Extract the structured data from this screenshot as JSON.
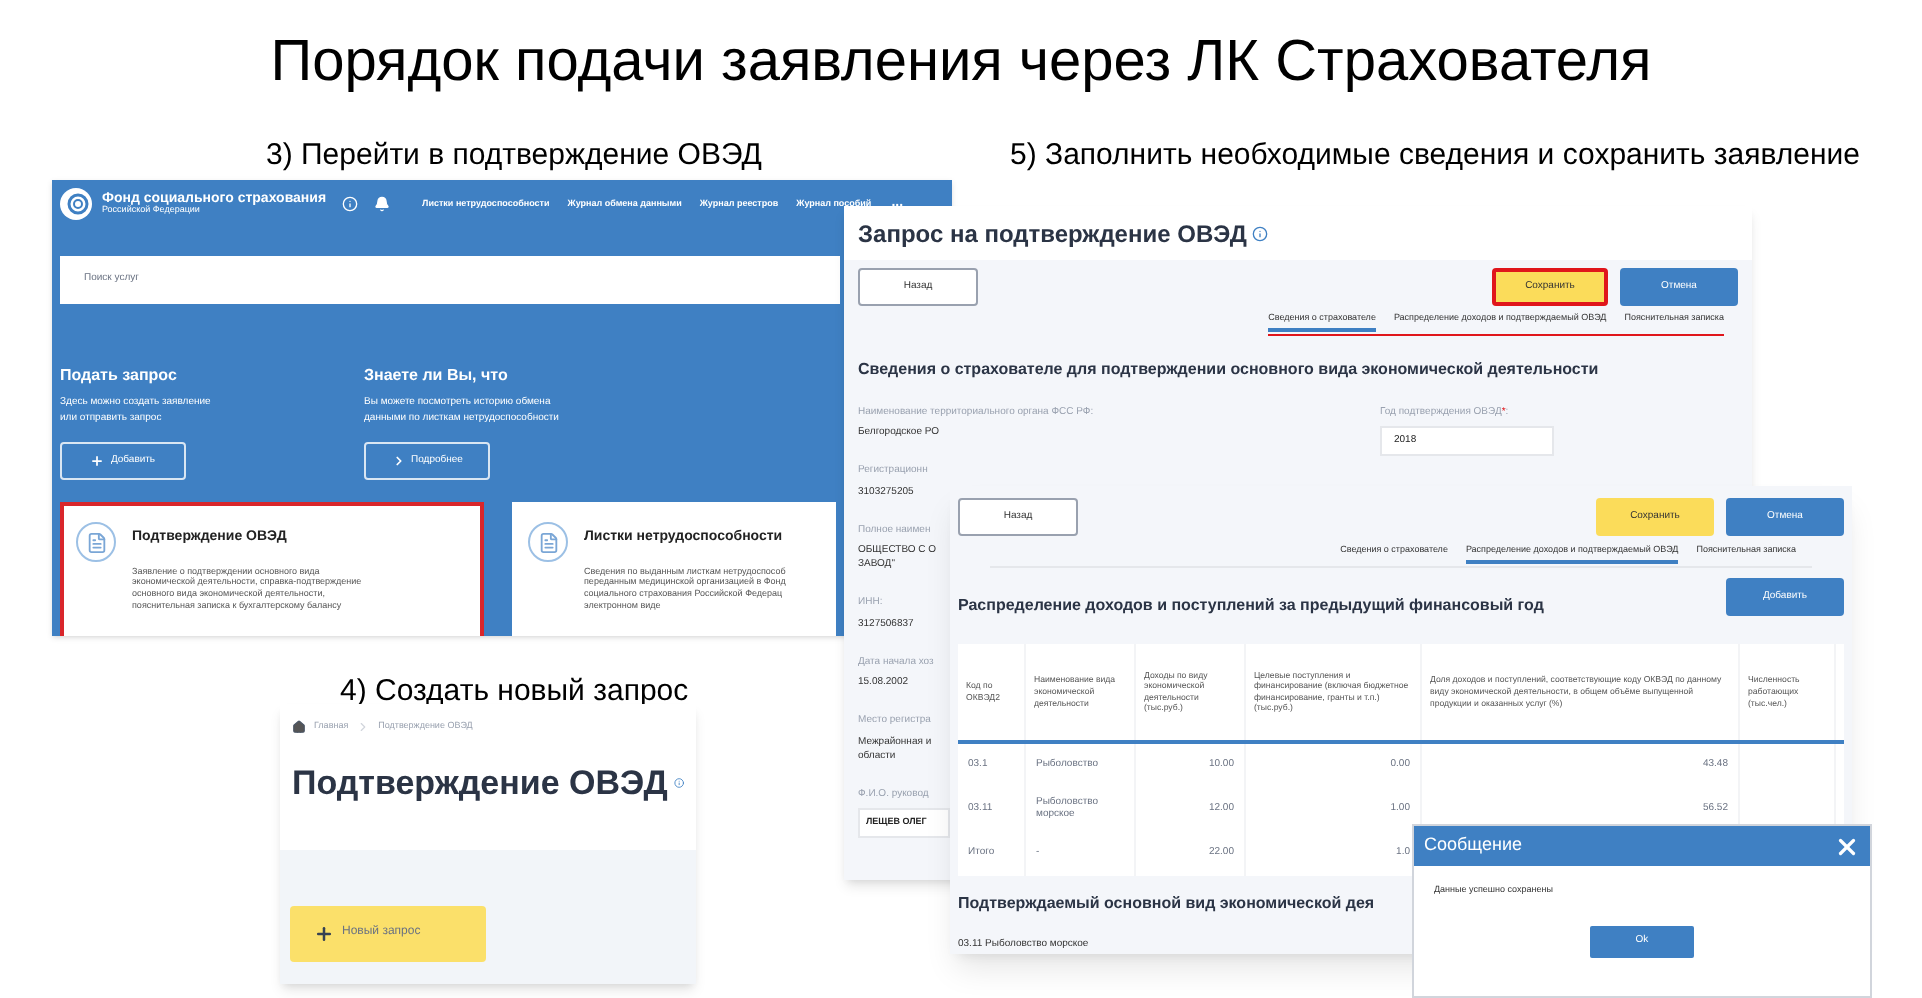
{
  "title": "Порядок подачи заявления через ЛК Страхователя",
  "captions": [
    {
      "kind": "portal",
      "text": "3) Перейти в подтверждение ОВЭД"
    },
    {
      "kind": "create",
      "text": "4) Создать новый запрос"
    },
    {
      "kind": "fill",
      "text": "5) Заполнить необходимые сведения и сохранить заявление"
    }
  ],
  "portal": {
    "logo_title": "Фонд социального страхования",
    "logo_subtitle": "Российской Федерации",
    "nav": [
      "Листки нетрудоспособности",
      "Журнал обмена данными",
      "Журнал реестров",
      "Журнал пособий"
    ],
    "more": "...",
    "search": {
      "placeholder": "Поиск услуг"
    },
    "sections": [
      {
        "heading": "Подать запрос",
        "text": "Здесь можно создать заявление\nили отправить запрос",
        "button": "Добавить",
        "kind": "add"
      },
      {
        "heading": "Знаете ли Вы, что",
        "text": "Вы можете посмотреть историю обмена\nданными по листкам нетрудоспособности",
        "button": "Подробнее",
        "kind": "more"
      }
    ],
    "cards": [
      {
        "title": "Подтверждение ОВЭД",
        "text": "Заявление о подтверждении основного вида\nэкономической деятельности, справка-подтверждение\nосновного вида экономической деятельности,\nпояснительная записка к бухгалтерскому балансу",
        "highlighted": true
      },
      {
        "title": "Листки нетрудоспособности",
        "text": "Сведения по выданным листкам нетрудоспособ\nпереданным медицинской организацией в Фонд\nсоциального страхования Российской Федерац\nэлектронном виде",
        "highlighted": false
      }
    ]
  },
  "ovzd": {
    "breadcrumbs": [
      "Главная",
      "Подтверждение ОВЭД"
    ],
    "title": "Подтверждение ОВЭД",
    "button": "Новый запрос"
  },
  "request": {
    "title": "Запрос на подтверждение ОВЭД",
    "back": "Назад",
    "save": {
      "label": "Сохранить",
      "highlighted": true
    },
    "cancel": "Отмена",
    "tabs": [
      {
        "label": "Сведения о страхователе",
        "selected": true
      },
      {
        "label": "Распределение доходов и подтверждаемый ОВЭД",
        "selected": false
      },
      {
        "label": "Пояснительная записка",
        "selected": false
      }
    ],
    "tabs_highlighted": true,
    "heading": "Сведения о страхователе для подтверждении основного вида экономической деятельности",
    "fields": [
      {
        "label": "Наименование территориального органа ФСС РФ:",
        "value": "Белгородское РО",
        "kind": "text"
      },
      {
        "label": "Регистрационн",
        "value": "3103275205",
        "kind": "text"
      },
      {
        "label": "Полное наимен",
        "value": "ОБЩЕСТВО С О\nЗАВОД\"",
        "kind": "text"
      },
      {
        "label": "ИНН:",
        "value": "3127506837",
        "kind": "text"
      },
      {
        "label": "Дата начала хоз",
        "value": "15.08.2002",
        "kind": "text"
      },
      {
        "label": "Место регистра",
        "value": "Межрайонная и\nобласти",
        "kind": "text"
      },
      {
        "label": "Ф.И.О. руковод",
        "value": "ЛЕЩЕВ ОЛЕГ",
        "kind": "input"
      }
    ],
    "year_field": {
      "label": "Год подтверждения ОВЭД",
      "required_mark": "*",
      "suffix": ":",
      "value": "2018"
    }
  },
  "distribution": {
    "back": "Назад",
    "save": {
      "label": "Сохранить",
      "highlighted": false
    },
    "cancel": "Отмена",
    "tabs": [
      {
        "label": "Сведения о страхователе",
        "selected": false
      },
      {
        "label": "Распределение доходов и подтверждаемый ОВЭД",
        "selected": true
      },
      {
        "label": "Пояснительная записка",
        "selected": false
      }
    ],
    "heading": "Распределение доходов и поступлений за предыдущий финансовый год",
    "add": "Добавить",
    "table": {
      "columns": [
        "Код по ОКВЭД2",
        "Наименование вида экономической деятельности",
        "Доходы по виду экономической деятельности (тыс.руб.)",
        "Целевые поступления и финансирование (включая бюджетное финансирование, гранты и т.п.) (тыс.руб.)",
        "Доля доходов и поступлений, соответствующие коду ОКВЭД по данному виду экономической деятельности, в общем объёме выпущенной продукции и оказанных услуг (%)",
        "Численность работающих (тыс.чел.)"
      ],
      "rows": [
        [
          "03.1",
          "Рыболовство",
          "10.00",
          "0.00",
          "43.48"
        ],
        [
          "03.11",
          "Рыболовство морское",
          "12.00",
          "1.00",
          "56.52"
        ],
        [
          "Итого",
          "-",
          "22.00",
          "1.0"
        ]
      ]
    },
    "heading2": "Подтверждаемый основной вид экономической дея",
    "value": "03.11 Рыболовство морское"
  },
  "dialog": {
    "title": "Сообщение",
    "text": "Данные успешно сохранены",
    "ok": "Ok"
  }
}
